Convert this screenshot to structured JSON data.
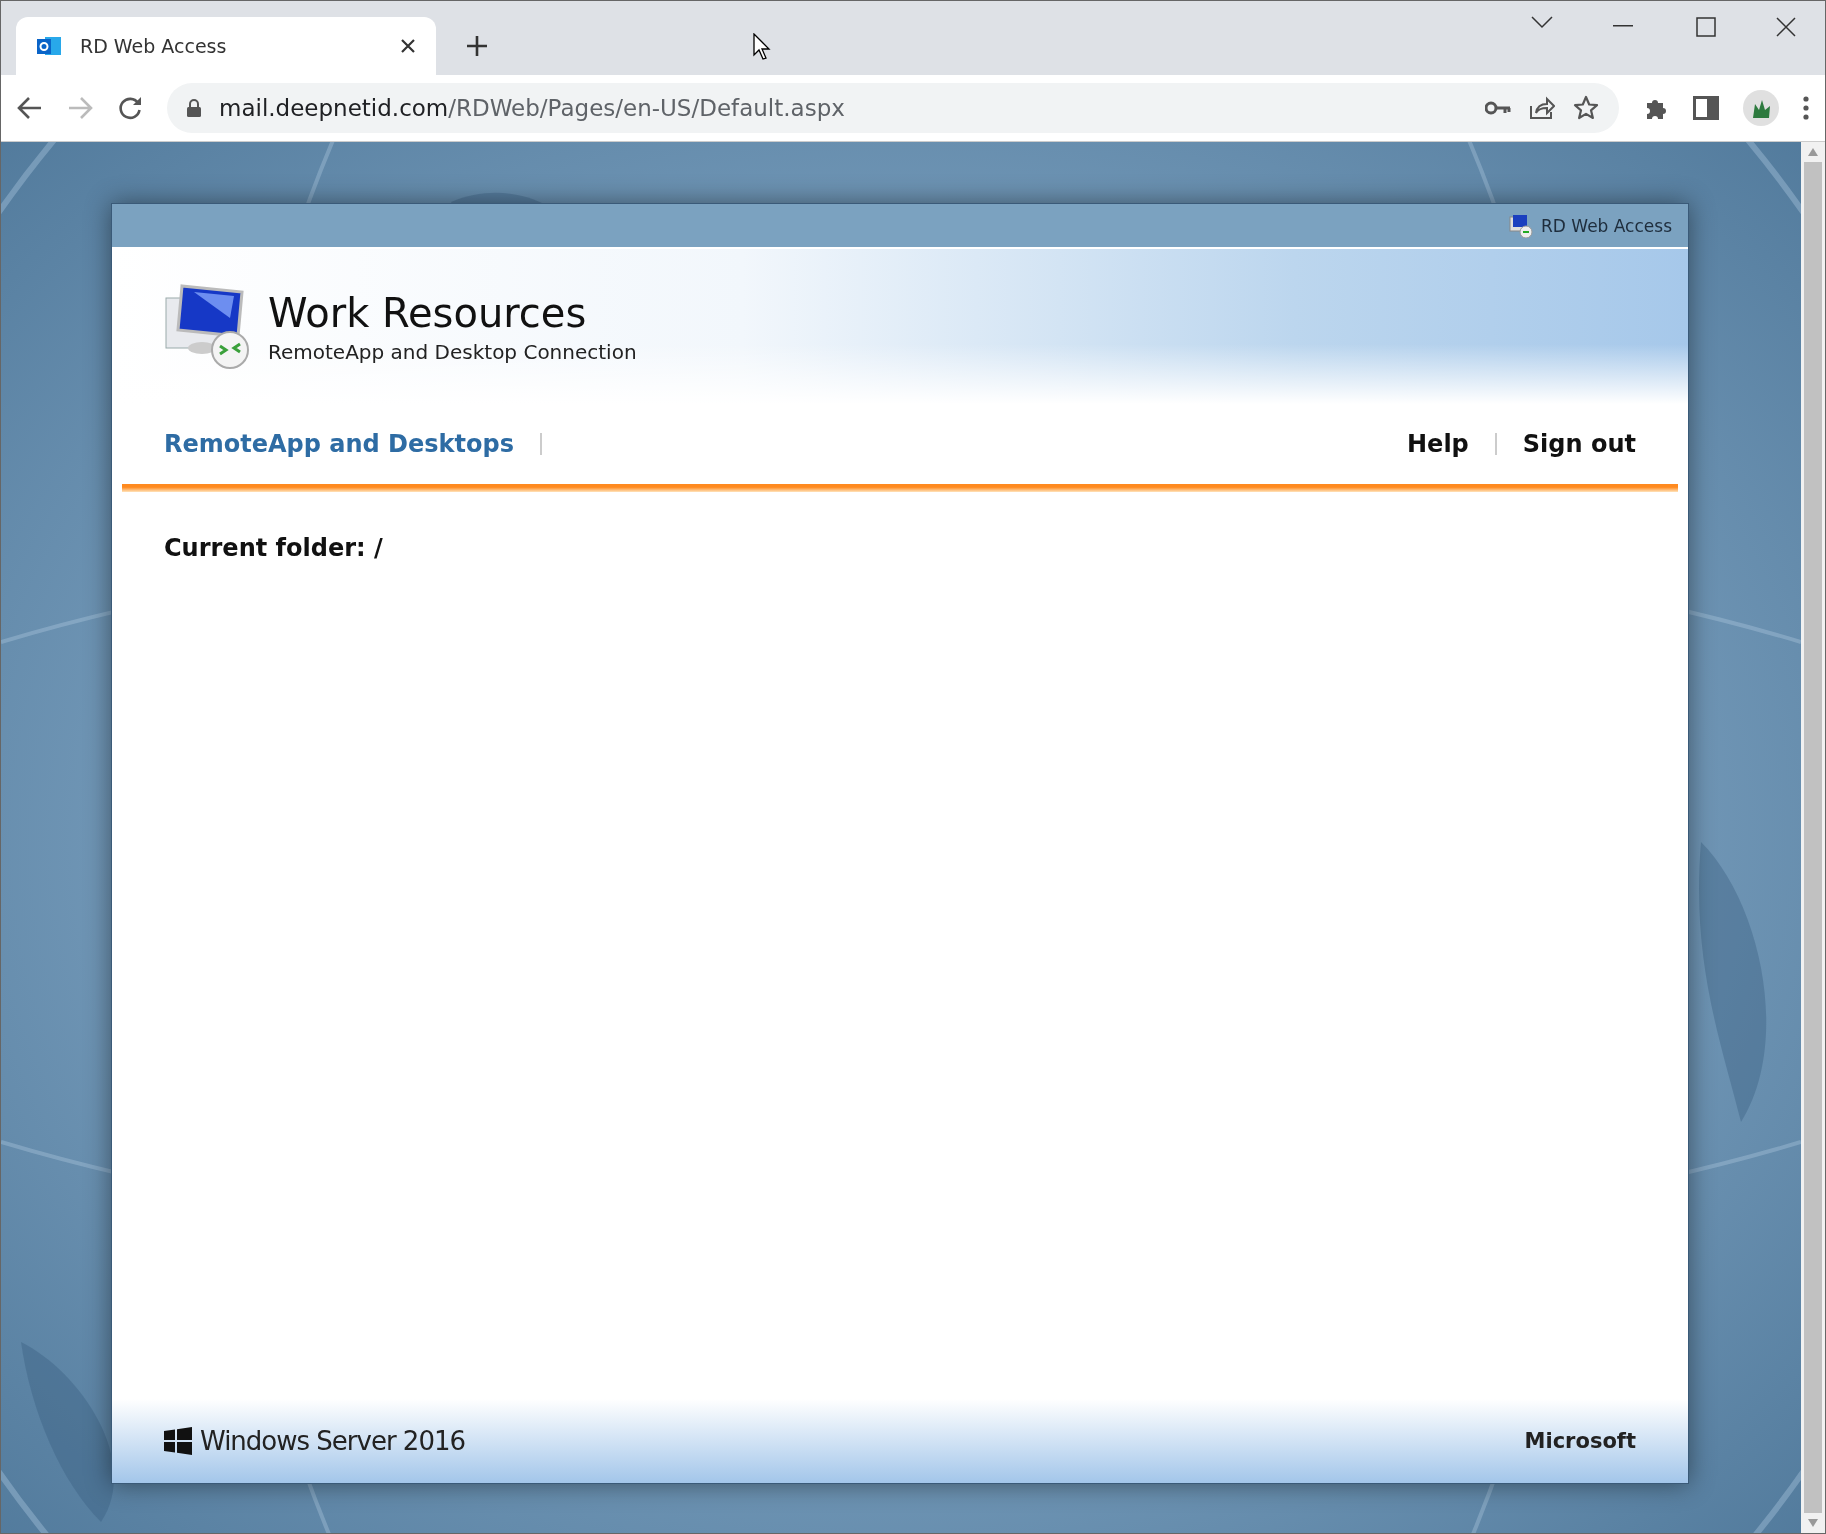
{
  "browser": {
    "tab": {
      "title": "RD Web Access",
      "selected": true
    },
    "address": {
      "domain": "mail.deepnetid.com",
      "path": "/RDWeb/Pages/en-US/Default.aspx"
    }
  },
  "page": {
    "top_bar": {
      "label": "RD Web Access"
    },
    "header": {
      "title": "Work Resources",
      "subtitle": "RemoteApp and Desktop Connection"
    },
    "nav": {
      "left": [
        {
          "label": "RemoteApp and Desktops",
          "selected": true
        }
      ],
      "right": [
        {
          "label": "Help",
          "selected": false
        },
        {
          "label": "Sign out",
          "selected": false
        }
      ]
    },
    "current_folder": "Current folder: /",
    "footer": {
      "product": "Windows Server 2016",
      "brand": "Microsoft"
    }
  }
}
